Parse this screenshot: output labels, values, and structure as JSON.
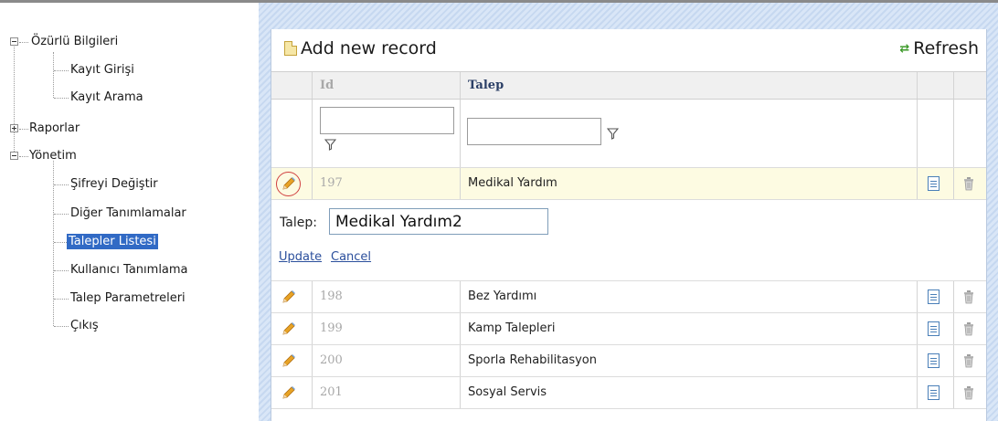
{
  "tree": {
    "root1": {
      "label": "Özürlü Bilgileri",
      "expanded": true,
      "children": [
        "Kayıt Girişi",
        "Kayıt Arama"
      ]
    },
    "root2": {
      "label": "Raporlar",
      "expanded": false
    },
    "root3": {
      "label": "Yönetim",
      "expanded": true,
      "children": [
        "Şifreyi Değiştir",
        "Diğer Tanımlamalar",
        "Talepler Listesi",
        "Kullanıcı Tanımlama",
        "Talep Parametreleri",
        "Çıkış"
      ],
      "selected": "Talepler Listesi"
    }
  },
  "toolbar": {
    "add_label": "Add new record",
    "refresh_label": "Refresh"
  },
  "columns": {
    "id": "Id",
    "talep": "Talep"
  },
  "filter": {
    "id_value": "",
    "talep_value": ""
  },
  "editing_row": {
    "id": "197",
    "talep": "Medikal Yardım"
  },
  "edit_form": {
    "label": "Talep:",
    "value": "Medikal Yardım2",
    "update": "Update",
    "cancel": "Cancel"
  },
  "rows": [
    {
      "id": "198",
      "talep": "Bez Yardımı"
    },
    {
      "id": "199",
      "talep": "Kamp Talepleri"
    },
    {
      "id": "200",
      "talep": "Sporla Rehabilitasyon"
    },
    {
      "id": "201",
      "talep": "Sosyal Servis"
    }
  ],
  "icons": {
    "edit": "pencil-icon",
    "view": "document-icon",
    "delete": "trash-icon",
    "filter": "funnel-icon"
  },
  "colors": {
    "selected_bg": "#316ac5",
    "editing_row_bg": "#fdfbe2",
    "link": "#2b4f9c",
    "accent_hatch": "#c6d8f0"
  }
}
